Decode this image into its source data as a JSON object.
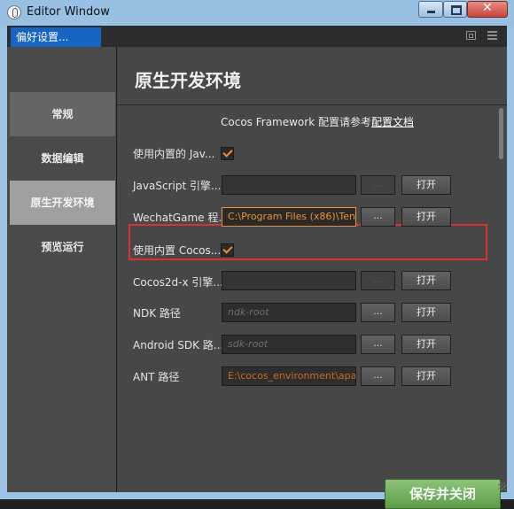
{
  "window": {
    "title": "Editor Window",
    "close_label": "✕"
  },
  "tab": {
    "label": "偏好设置..."
  },
  "sidebar": {
    "items": [
      {
        "label": "常规"
      },
      {
        "label": "数据编辑"
      },
      {
        "label": "原生开发环境"
      },
      {
        "label": "预览运行"
      }
    ]
  },
  "main": {
    "heading": "原生开发环境",
    "note_prefix": "Cocos Framework 配置请参考",
    "note_link": "配置文档",
    "rows": [
      {
        "label": "使用内置的 Jav..."
      },
      {
        "label": "JavaScript 引擎...",
        "dots": "...",
        "open": "打开"
      },
      {
        "label": "WechatGame 程...",
        "value": "C:\\Program Files (x86)\\Ten",
        "dots": "...",
        "open": "打开"
      },
      {
        "label": "使用内置 Cocos..."
      },
      {
        "label": "Cocos2d-x 引擎...",
        "dots": "...",
        "open": "打开"
      },
      {
        "label": "NDK 路径",
        "placeholder": "ndk-root",
        "dots": "...",
        "open": "打开"
      },
      {
        "label": "Android SDK 路...",
        "placeholder": "sdk-root",
        "dots": "...",
        "open": "打开"
      },
      {
        "label": "ANT 路径",
        "value": "E:\\cocos_environment\\apa",
        "dots": "...",
        "open": "打开"
      }
    ],
    "save_label": "保存并关闭"
  },
  "colors": {
    "accent": "#f0902e",
    "highlight_box": "#e0302e",
    "save_button": "#6aa855",
    "tab_active": "#1664c3"
  }
}
